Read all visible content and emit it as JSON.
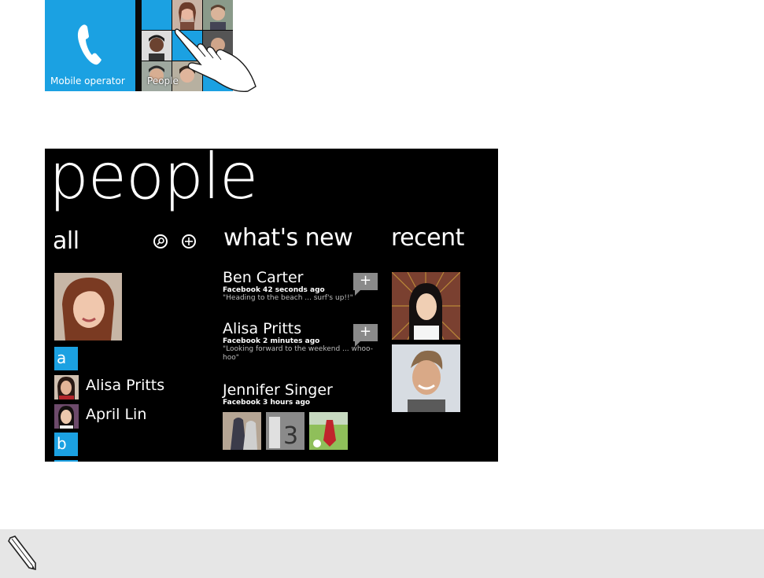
{
  "start_screen": {
    "tiles": [
      {
        "label": "Mobile operator",
        "icon": "phone-handset-icon",
        "color": "#1ba1e2"
      },
      {
        "label": "People",
        "icon": "people-photo-collage"
      }
    ],
    "gesture": "hand-tap-icon"
  },
  "people_hub": {
    "title": "people",
    "sections": {
      "all": {
        "heading": "all",
        "icons": [
          "search-icon",
          "add-icon"
        ],
        "letter_groups": [
          "a",
          "b"
        ],
        "contacts": [
          "Alisa Pritts",
          "April Lin"
        ]
      },
      "whats_new": {
        "heading": "what's new",
        "items": [
          {
            "name": "Ben Carter",
            "source": "Facebook 42 seconds ago",
            "text": "\"Heading to the beach ... surf's up!!\"",
            "comment_label": "+"
          },
          {
            "name": "Alisa Pritts",
            "source": "Facebook 2 minutes ago",
            "text": "\"Looking forward to the weekend ... whoo-hoo\"",
            "comment_label": "+"
          },
          {
            "name": "Jennifer Singer",
            "source": "Facebook 3 hours ago",
            "text": ""
          }
        ]
      },
      "recent": {
        "heading": "recent"
      }
    },
    "accent_color": "#1ba1e2"
  },
  "note_bar": {
    "icon": "pencil-icon"
  }
}
